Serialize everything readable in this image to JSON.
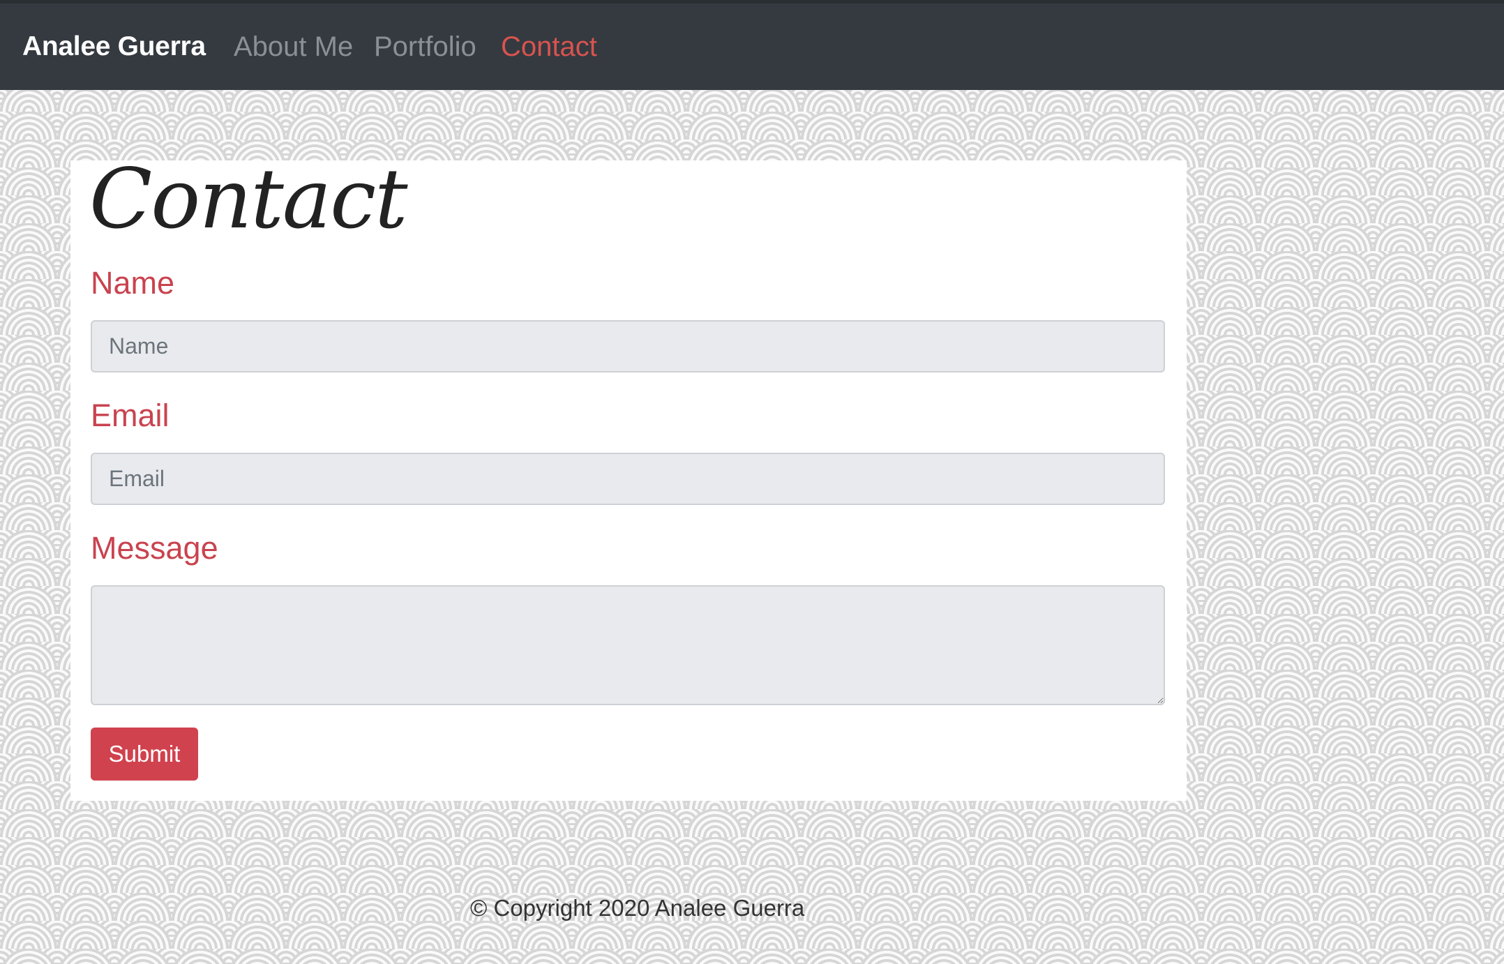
{
  "nav": {
    "brand": "Analee Guerra",
    "links": [
      {
        "label": "About Me"
      },
      {
        "label": "Portfolio"
      },
      {
        "label": "Contact"
      }
    ],
    "active": "Contact"
  },
  "page": {
    "title": "Contact"
  },
  "form": {
    "name_label": "Name",
    "name_placeholder": "Name",
    "email_label": "Email",
    "email_placeholder": "Email",
    "message_label": "Message",
    "submit_label": "Submit"
  },
  "footer": {
    "copyright": "© Copyright 2020 Analee Guerra"
  },
  "colors": {
    "navbar": "#343a40",
    "accent": "#d0424e",
    "background_pattern": "#d6d6d6"
  }
}
